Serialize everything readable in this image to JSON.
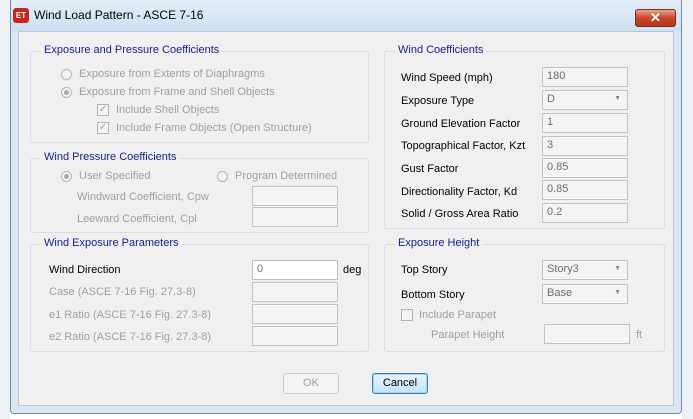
{
  "window": {
    "title": "Wind Load Pattern - ASCE 7-16",
    "icon_text": "ET",
    "close_symbol": "✕"
  },
  "exposure": {
    "title": "Exposure and Pressure Coefficients",
    "opt_diaphragms": "Exposure from Extents of Diaphragms",
    "opt_frame_shell": "Exposure from Frame and Shell Objects",
    "include_shell": "Include Shell Objects",
    "include_frame": "Include Frame Objects (Open Structure)",
    "selected_option": "Exposure from Frame and Shell Objects",
    "include_shell_checked": true,
    "include_frame_checked": true
  },
  "pressure": {
    "title": "Wind Pressure Coefficients",
    "opt_user": "User Specified",
    "opt_program": "Program Determined",
    "windward_label": "Windward Coefficient, Cpw",
    "windward_value": "",
    "leeward_label": "Leeward Coefficient, Cpl",
    "leeward_value": "",
    "selected_option": "User Specified"
  },
  "exposure_params": {
    "title": "Wind Exposure Parameters",
    "wind_direction_label": "Wind Direction",
    "wind_direction_value": "0",
    "wind_direction_unit": "deg",
    "case_label": "Case  (ASCE 7-16 Fig. 27.3-8)",
    "case_value": "",
    "e1_label": "e1 Ratio  (ASCE 7-16 Fig. 27.3-8)",
    "e1_value": "",
    "e2_label": "e2 Ratio  (ASCE 7-16 Fig. 27.3-8)",
    "e2_value": ""
  },
  "coefficients": {
    "title": "Wind Coefficients",
    "wind_speed_label": "Wind Speed (mph)",
    "wind_speed_value": "180",
    "exposure_type_label": "Exposure Type",
    "exposure_type_value": "D",
    "ground_elev_label": "Ground Elevation Factor",
    "ground_elev_value": "1",
    "topo_label": "Topographical Factor, Kzt",
    "topo_value": "3",
    "gust_label": "Gust Factor",
    "gust_value": "0.85",
    "directionality_label": "Directionality Factor, Kd",
    "directionality_value": "0.85",
    "solid_label": "Solid / Gross Area Ratio",
    "solid_value": "0.2"
  },
  "height": {
    "title": "Exposure Height",
    "top_label": "Top Story",
    "top_value": "Story3",
    "bottom_label": "Bottom Story",
    "bottom_value": "Base",
    "include_parapet": "Include Parapet",
    "include_parapet_checked": false,
    "parapet_height_label": "Parapet Height",
    "parapet_height_value": "",
    "parapet_unit": "ft"
  },
  "buttons": {
    "ok": "OK",
    "cancel": "Cancel"
  },
  "icons": {
    "dropdown_arrow": "chevron-down-icon",
    "check": "checkmark-icon"
  }
}
